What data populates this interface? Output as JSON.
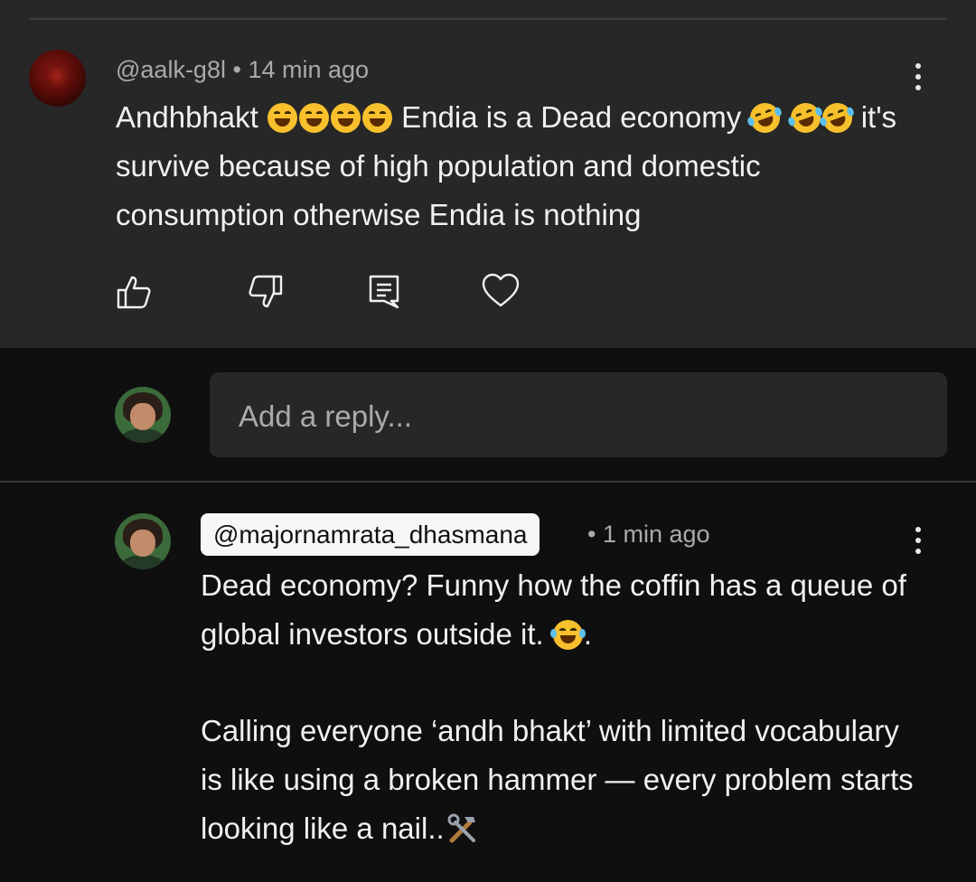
{
  "top_comment": {
    "author": "@aalk-g8l",
    "separator": " • ",
    "time": "14 min ago",
    "text_word1": "Andhbhakt",
    "text_part2": " Endia is a Dead economy ",
    "text_part3": " it's survive because of high population and domestic consumption otherwise Endia is nothing",
    "emoji_laugh": "grinning-squinting-face",
    "emoji_rofl": "rolling-on-the-floor-laughing"
  },
  "actions": {
    "like_icon": "thumbs-up-icon",
    "dislike_icon": "thumbs-down-icon",
    "reply_icon": "reply-comment-icon",
    "heart_icon": "heart-icon"
  },
  "reply_box": {
    "placeholder": "Add a reply..."
  },
  "reply_comment": {
    "author": "@majornamrata_dhasmana",
    "time": "• 1 min ago",
    "line1a": "Dead economy? Funny how the coffin has a queue of global investors outside it. ",
    "line1b": ".",
    "para2": "Calling everyone ‘andh bhakt’  with limited vocabulary is like using a broken hammer — every problem starts looking like a nail..",
    "emoji_joy": "face-with-tears-of-joy",
    "emoji_tools": "hammer-and-wrench"
  },
  "colors": {
    "top_bg": "#272727",
    "page_bg": "#0f0f0f",
    "meta_text": "#aaaaaa",
    "body_text": "#f1f1f1"
  }
}
